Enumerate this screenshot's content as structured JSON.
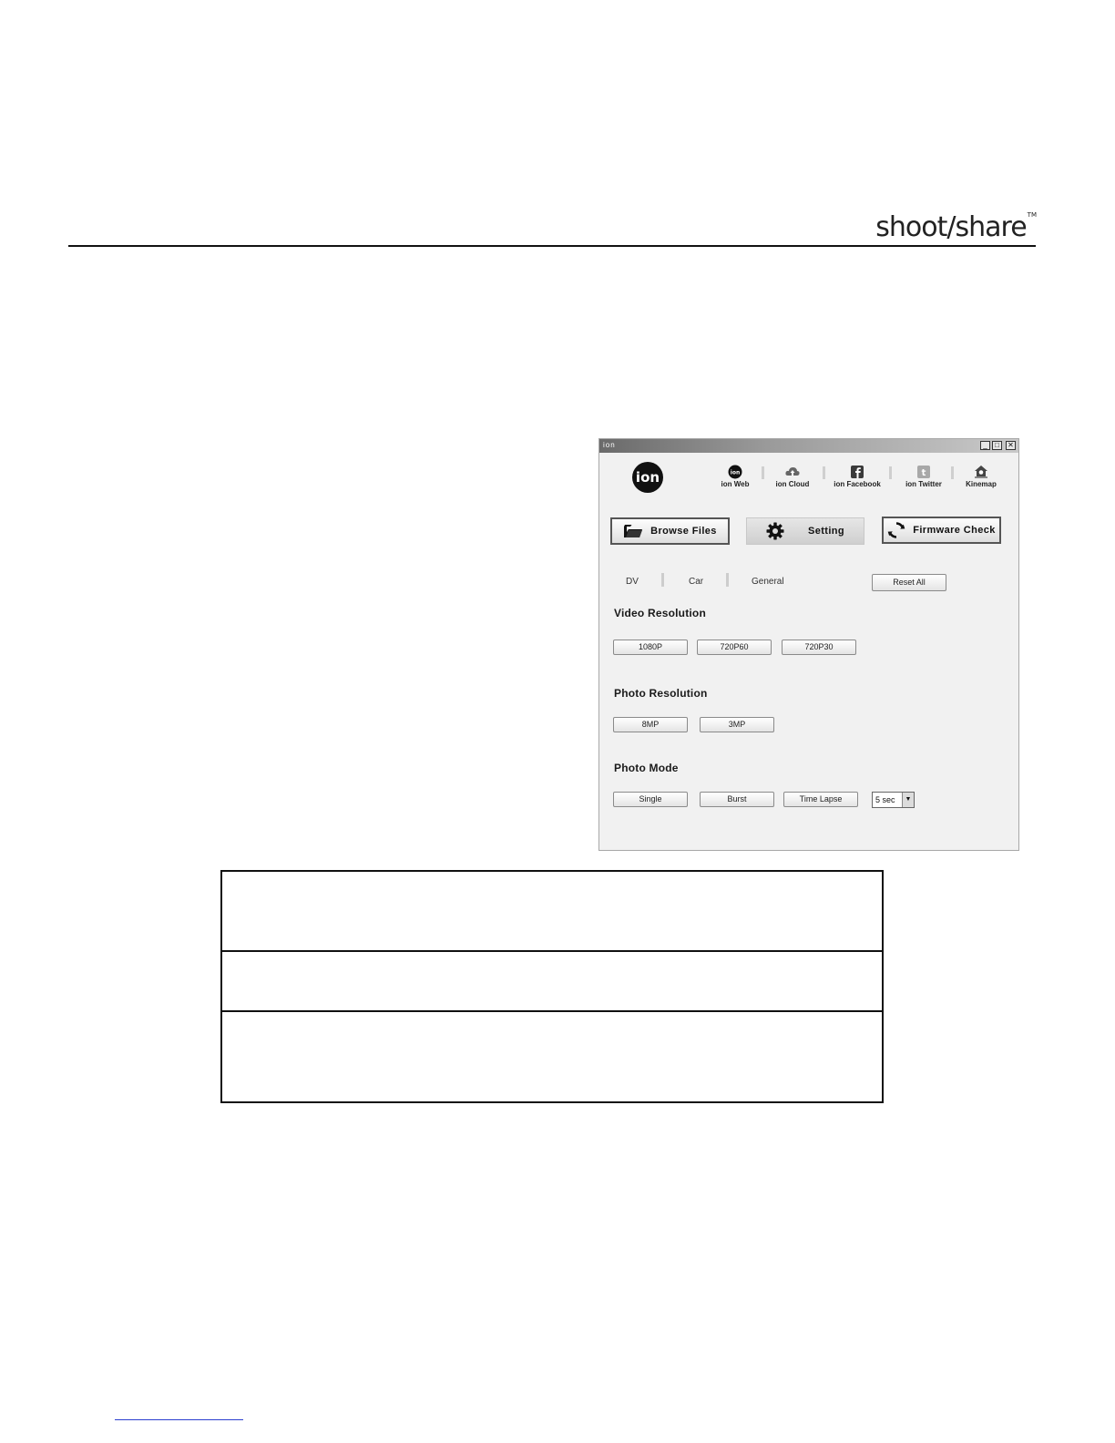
{
  "header": {
    "brand": "shoot/share",
    "trademark": "TM"
  },
  "window": {
    "title": "ion",
    "controls": {
      "minimize": "_",
      "maximize": "□",
      "close": "✕"
    },
    "logo_text": "ion",
    "links": [
      {
        "label": "ion Web",
        "icon": "ion-web-icon"
      },
      {
        "label": "ion Cloud",
        "icon": "cloud-upload-icon"
      },
      {
        "label": "ion Facebook",
        "icon": "facebook-icon"
      },
      {
        "label": "ion Twitter",
        "icon": "twitter-icon"
      },
      {
        "label": "Kinemap",
        "icon": "kinemap-icon"
      }
    ],
    "main_buttons": {
      "browse": "Browse Files",
      "setting": "Setting",
      "firmware": "Firmware Check"
    },
    "tabs": [
      "DV",
      "Car",
      "General"
    ],
    "reset_all": "Reset All",
    "video_resolution": {
      "title": "Video Resolution",
      "options": [
        "1080P",
        "720P60",
        "720P30"
      ]
    },
    "photo_resolution": {
      "title": "Photo Resolution",
      "options": [
        "8MP",
        "3MP"
      ]
    },
    "photo_mode": {
      "title": "Photo Mode",
      "options": [
        "Single",
        "Burst",
        "Time Lapse"
      ],
      "interval": "5 sec"
    }
  }
}
